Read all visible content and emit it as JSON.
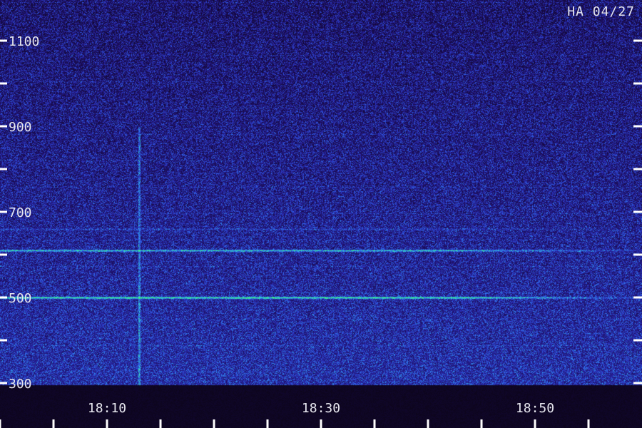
{
  "station": {
    "label": "HA 04/27"
  },
  "chart_data": {
    "type": "heatmap",
    "title": "",
    "xlabel": "",
    "ylabel": "",
    "y_axis": {
      "range": [
        300,
        1200
      ],
      "labeled_ticks": [
        "1100",
        "900",
        "700",
        "500",
        "300"
      ],
      "labeled_tick_values": [
        1100,
        900,
        700,
        500,
        300
      ],
      "minor_tick_values": [
        1000,
        800,
        600,
        400
      ]
    },
    "x_axis": {
      "range_minutes": [
        "18:05",
        "18:55"
      ],
      "labeled_ticks": [
        "18:10",
        "18:30",
        "18:50"
      ],
      "labeled_tick_values": [
        "18:10",
        "18:30",
        "18:50"
      ],
      "minor_tick_values": [
        "18:00",
        "18:05",
        "18:15",
        "18:20",
        "18:25",
        "18:35",
        "18:40",
        "18:45",
        "18:55"
      ]
    },
    "carriers": [
      {
        "frequency": 500,
        "strength": 1.0
      },
      {
        "frequency": 610,
        "strength": 0.75
      },
      {
        "frequency": 660,
        "strength": 0.2
      }
    ],
    "transient_time": "18:13",
    "colormap": [
      "#0b0414",
      "#1b0d5a",
      "#2a2ab0",
      "#2f62e8",
      "#2fc4e0",
      "#3cf07a"
    ]
  }
}
